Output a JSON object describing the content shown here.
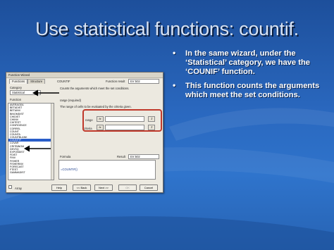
{
  "slide": {
    "title": "Use statistical functions: countif.",
    "bullets": [
      "In the same wizard, under the ‘Statistical’ category, we have the ‘COUNIF’ function.",
      "This function counts the arguments which meet the set conditions."
    ],
    "bullet_glyph": "•"
  },
  "dialog": {
    "title": "Function Wizard",
    "tabs": [
      "Functions",
      "Structure"
    ],
    "category_label": "Category",
    "category_value": "Statistical",
    "function_label": "Function",
    "functions": [
      "AVERAGEA",
      "BETADIST",
      "BETAINV",
      "BINOMDIST",
      "CHIDIST",
      "CHIINV",
      "CHITEST",
      "CONFIDENCE",
      "CORREL",
      "COUNT",
      "COUNTA",
      "COUNTBLANK",
      "COUNTIF",
      "COVAR",
      "CRITBINOM",
      "DEVSQ",
      "EXPONDIST",
      "FDIST",
      "FINV",
      "FISHER",
      "FISHERINV",
      "FORECAST",
      "FTEST",
      "GAMMADIST"
    ],
    "selected_function": "COUNTIF",
    "function_name": "COUNTIF",
    "function_result_label": "Function result",
    "function_result_value": "Err:502",
    "description": "Counts the arguments which meet the set conditions.",
    "param_required": "range (required)",
    "param_desc": "The range of cells to be evaluated by the criteria given.",
    "args": [
      {
        "label": "range",
        "fx": "fx",
        "value": ""
      },
      {
        "label": "criteria",
        "fx": "fx",
        "value": ""
      }
    ],
    "formula_label": "Formula",
    "result_label": "Result",
    "result_value": "Err:502",
    "formula_text": "=COUNTIF()",
    "array_label": "Array",
    "buttons": {
      "help": "Help",
      "back": "<< Back",
      "next": "Next >>",
      "ok": "OK",
      "cancel": "Cancel"
    }
  },
  "colors": {
    "background": "#2a68bf",
    "highlight_box": "#c0392b",
    "selection": "#2a5ec9",
    "arrow": "#000000"
  }
}
